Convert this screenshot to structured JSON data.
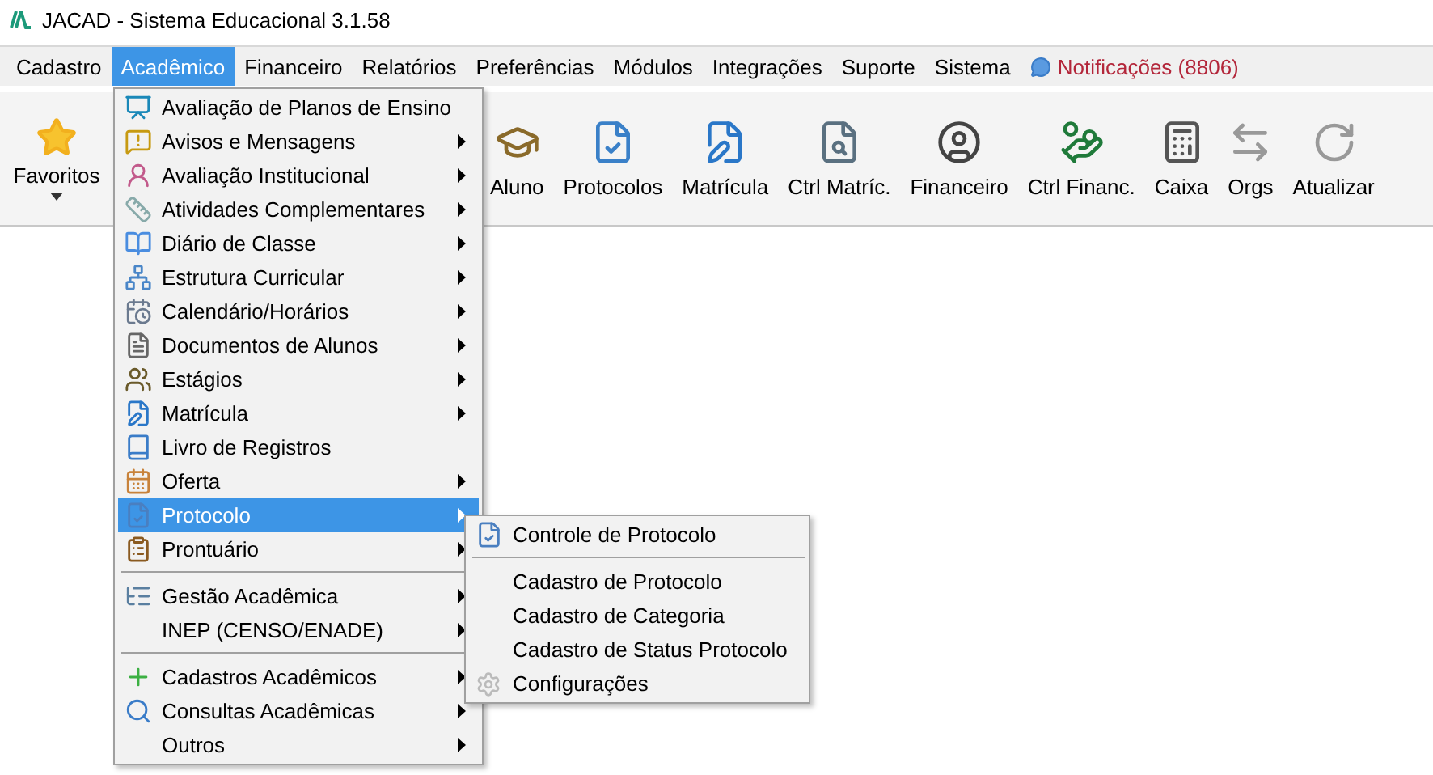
{
  "window": {
    "title": "JACAD - Sistema Educacional 3.1.58"
  },
  "menu_bar": [
    {
      "label": "Cadastro",
      "selected": false
    },
    {
      "label": "Acadêmico",
      "selected": true
    },
    {
      "label": "Financeiro",
      "selected": false
    },
    {
      "label": "Relatórios",
      "selected": false
    },
    {
      "label": "Preferências",
      "selected": false
    },
    {
      "label": "Módulos",
      "selected": false
    },
    {
      "label": "Integrações",
      "selected": false
    },
    {
      "label": "Suporte",
      "selected": false
    },
    {
      "label": "Sistema",
      "selected": false
    }
  ],
  "notifications": {
    "label": "Notificações (8806)"
  },
  "toolbar": {
    "favorites": "Favoritos",
    "buttons": [
      "Aluno",
      "Protocolos",
      "Matrícula",
      "Ctrl Matríc.",
      "Financeiro",
      "Ctrl Financ.",
      "Caixa",
      "Orgs",
      "Atualizar"
    ]
  },
  "academic_menu": {
    "groups": [
      [
        {
          "label": "Avaliação de Planos de Ensino",
          "submenu": false,
          "selected": false
        },
        {
          "label": "Avisos e Mensagens",
          "submenu": true,
          "selected": false
        },
        {
          "label": "Avaliação Institucional",
          "submenu": true,
          "selected": false
        },
        {
          "label": "Atividades Complementares",
          "submenu": true,
          "selected": false
        },
        {
          "label": "Diário de Classe",
          "submenu": true,
          "selected": false
        },
        {
          "label": "Estrutura Curricular",
          "submenu": true,
          "selected": false
        },
        {
          "label": "Calendário/Horários",
          "submenu": true,
          "selected": false
        },
        {
          "label": "Documentos de Alunos",
          "submenu": true,
          "selected": false
        },
        {
          "label": "Estágios",
          "submenu": true,
          "selected": false
        },
        {
          "label": "Matrícula",
          "submenu": true,
          "selected": false
        },
        {
          "label": "Livro de Registros",
          "submenu": false,
          "selected": false
        },
        {
          "label": "Oferta",
          "submenu": true,
          "selected": false
        },
        {
          "label": "Protocolo",
          "submenu": true,
          "selected": true
        },
        {
          "label": "Prontuário",
          "submenu": true,
          "selected": false
        }
      ],
      [
        {
          "label": "Gestão Acadêmica",
          "submenu": true,
          "selected": false
        },
        {
          "label": "INEP (CENSO/ENADE)",
          "submenu": true,
          "selected": false
        }
      ],
      [
        {
          "label": "Cadastros Acadêmicos",
          "submenu": true,
          "selected": false
        },
        {
          "label": "Consultas Acadêmicas",
          "submenu": true,
          "selected": false
        },
        {
          "label": "Outros",
          "submenu": true,
          "selected": false
        }
      ]
    ]
  },
  "protocol_submenu": {
    "groups": [
      [
        {
          "label": "Controle de Protocolo"
        }
      ],
      [
        {
          "label": "Cadastro de Protocolo"
        },
        {
          "label": "Cadastro de Categoria"
        },
        {
          "label": "Cadastro de Status Protocolo"
        },
        {
          "label": "Configurações"
        }
      ]
    ]
  }
}
